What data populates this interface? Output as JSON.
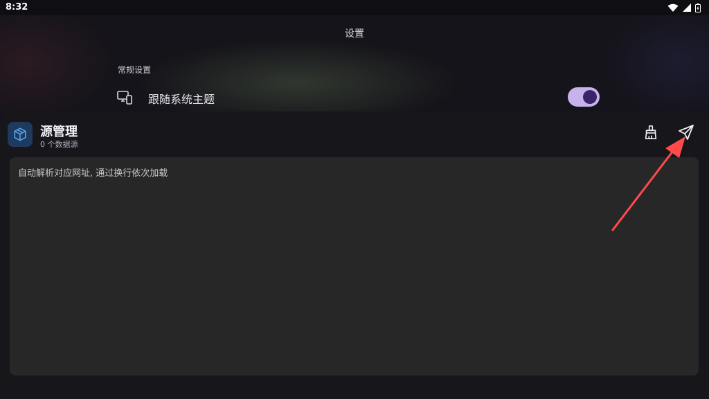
{
  "status_bar": {
    "time": "8:32",
    "icons": [
      "wifi-icon",
      "signal-icon",
      "battery-icon"
    ]
  },
  "settings_page": {
    "title": "设置",
    "section_header": "常规设置",
    "follow_system_theme": {
      "label": "跟随系统主题",
      "icon": "devices-icon",
      "enabled": true
    }
  },
  "source_sheet": {
    "icon": "package-icon",
    "title": "源管理",
    "subtitle": "0 个数据源",
    "actions": {
      "clean": "broom-icon",
      "send": "send-icon"
    },
    "input": {
      "value": "",
      "placeholder": "自动解析对应网址, 通过换行依次加载"
    }
  },
  "colors": {
    "toggle_track": "#c6b3ec",
    "toggle_thumb": "#3a2366",
    "app_icon_bg": "#1e3a5f",
    "app_icon_fg": "#5aa3f0",
    "arrow": "#ff4a4a"
  }
}
